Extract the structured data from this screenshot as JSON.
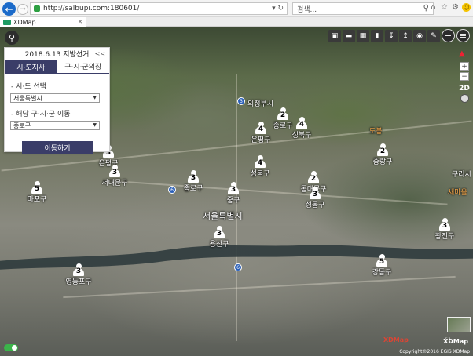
{
  "browser": {
    "url": "http://salbupi.com:180601/",
    "search_placeholder": "검색...",
    "tab_title": "XDMap",
    "back_icon": "back-arrow-icon"
  },
  "panel": {
    "title": "2018.6.13 지방선거",
    "collapse": "<<",
    "tabs": [
      "시·도지사",
      "구·시·군의장"
    ],
    "label_province": "- 시·도 선택",
    "province_value": "서울특별시",
    "label_district": "- 해당 구·시·군 이동",
    "district_value": "종로구",
    "move_button": "이동하기"
  },
  "map": {
    "city_label": "서울특별시",
    "places": [
      "성북구",
      "구리시",
      "광진구",
      "새마을",
      "도봉",
      "의정부시"
    ],
    "markers": [
      {
        "num": "2",
        "name": "종로구"
      },
      {
        "num": "4",
        "name": "성북구"
      },
      {
        "num": "4",
        "name": "은평구"
      },
      {
        "num": "2",
        "name": "중랑구"
      },
      {
        "num": "3",
        "name": "은평구"
      },
      {
        "num": "3",
        "name": "서대문구"
      },
      {
        "num": "5",
        "name": "마포구"
      },
      {
        "num": "3",
        "name": "종로구"
      },
      {
        "num": "3",
        "name": "중구"
      },
      {
        "num": "4",
        "name": "성북구"
      },
      {
        "num": "2",
        "name": "동대문구"
      },
      {
        "num": "3",
        "name": "성동구"
      },
      {
        "num": "3",
        "name": "용산구"
      },
      {
        "num": "3",
        "name": "광진구"
      },
      {
        "num": "3",
        "name": "영등포구"
      },
      {
        "num": "5",
        "name": "강동구"
      }
    ],
    "modes": [
      "2D"
    ],
    "xdmap_logo": "XDMap",
    "copyright": "Copyright©2016 EGIS XDMap"
  }
}
